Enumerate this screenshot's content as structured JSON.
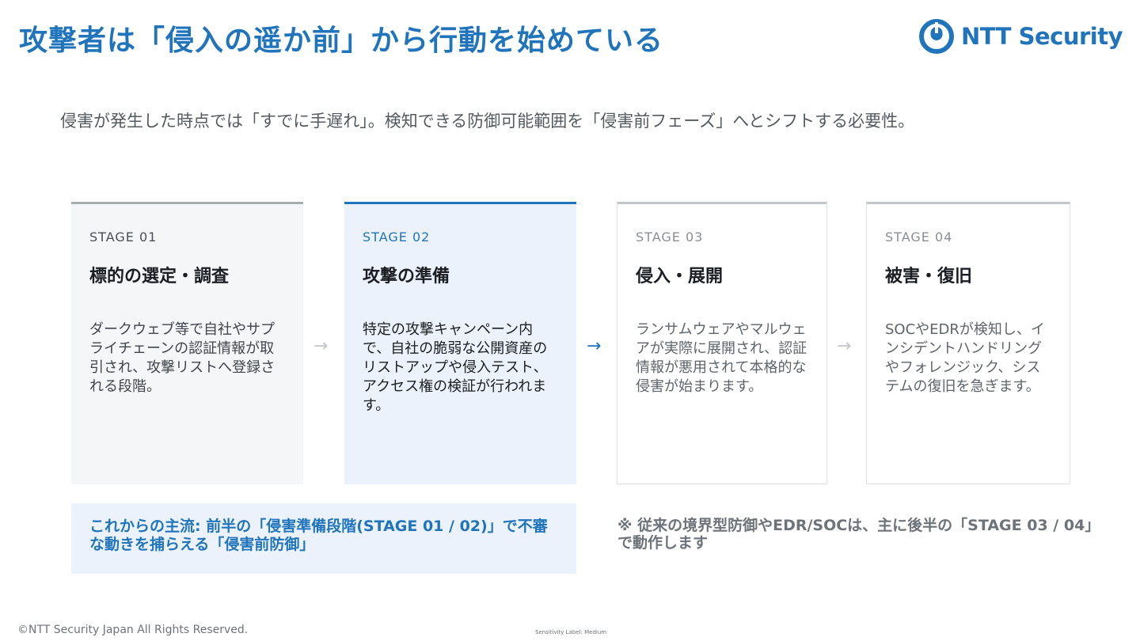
{
  "slide": {
    "title": "攻撃者は「侵入の遥か前」から行動を始めている",
    "subtitle": "侵害が発生した時点では「すでに手遅れ」。検知できる防御可能範囲を「侵害前フェーズ」へとシフトする必要性。",
    "logo_text": "NTT Security",
    "colors": {
      "brand": "#1f74bc",
      "active_card_bg": "#ebf2fb",
      "inactive_border": "#c3c6ca"
    }
  },
  "stages": [
    {
      "label": "STAGE 01",
      "title": "標的の選定・調査",
      "description": "ダークウェブ等で自社やサプライチェーンの認証情報が取引され、攻撃リストへ登録される段階。"
    },
    {
      "label": "STAGE 02",
      "title": "攻撃の準備",
      "description": "特定の攻撃キャンペーン内で、自社の脆弱な公開資産のリストアップや侵入テスト、アクセス権の検証が行われます。"
    },
    {
      "label": "STAGE 03",
      "title": "侵入・展開",
      "description": "ランサムウェアやマルウェアが実際に展開され、認証情報が悪用されて本格的な侵害が始まります。"
    },
    {
      "label": "STAGE 04",
      "title": "被害・復旧",
      "description": "SOCやEDRが検知し、インシデントハンドリングやフォレンジック、システムの復旧を急ぎます。"
    }
  ],
  "arrows": {
    "glyph": "→",
    "icon": "arrow-right-icon"
  },
  "callout": {
    "text": "これからの主流: 前半の「侵害準備段階(STAGE 01 / 02)」で不審な動きを捕らえる「侵害前防御」"
  },
  "note": {
    "text": "※ 従来の境界型防御やEDR/SOCは、主に後半の「STAGE 03 / 04」で動作します"
  },
  "footer": {
    "copyright": "©NTT Security Japan All Rights Reserved.",
    "sensitivity": "Sensitivity Label: Medium"
  }
}
